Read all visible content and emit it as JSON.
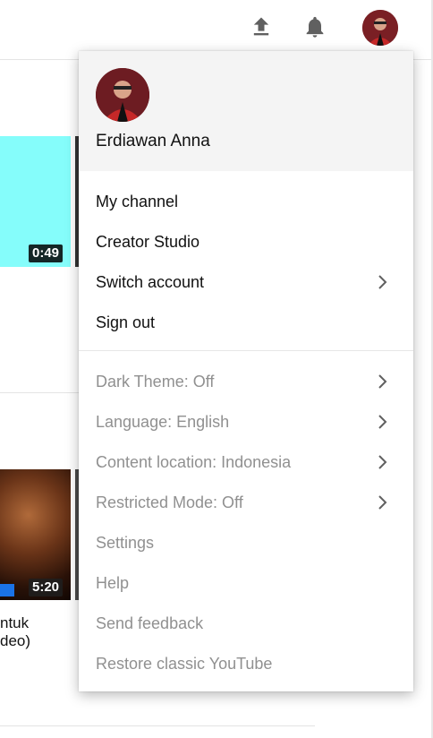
{
  "topbar": {
    "upload_icon": "upload-icon",
    "notifications_icon": "bell-icon",
    "avatar": "account-avatar"
  },
  "background": {
    "video1_duration": "0:49",
    "video2_duration": "5:20",
    "video2_title_line1": "ntuk",
    "video2_title_line2": "deo)"
  },
  "account_menu": {
    "user_name": "Erdiawan Anna",
    "primary_items": [
      {
        "label": "My channel"
      },
      {
        "label": "Creator Studio"
      },
      {
        "label": "Switch account",
        "has_submenu": true
      },
      {
        "label": "Sign out"
      }
    ],
    "secondary_items": [
      {
        "label": "Dark Theme: Off",
        "has_submenu": true
      },
      {
        "label": "Language: English",
        "has_submenu": true
      },
      {
        "label": "Content location: Indonesia",
        "has_submenu": true
      },
      {
        "label": "Restricted Mode: Off",
        "has_submenu": true
      },
      {
        "label": "Settings"
      },
      {
        "label": "Help"
      },
      {
        "label": "Send feedback"
      },
      {
        "label": "Restore classic YouTube"
      }
    ]
  },
  "colors": {
    "menu_header_bg": "#f4f4f4",
    "primary_text": "#111111",
    "secondary_text": "#909090",
    "thumb_cyan": "#85fdfb"
  }
}
